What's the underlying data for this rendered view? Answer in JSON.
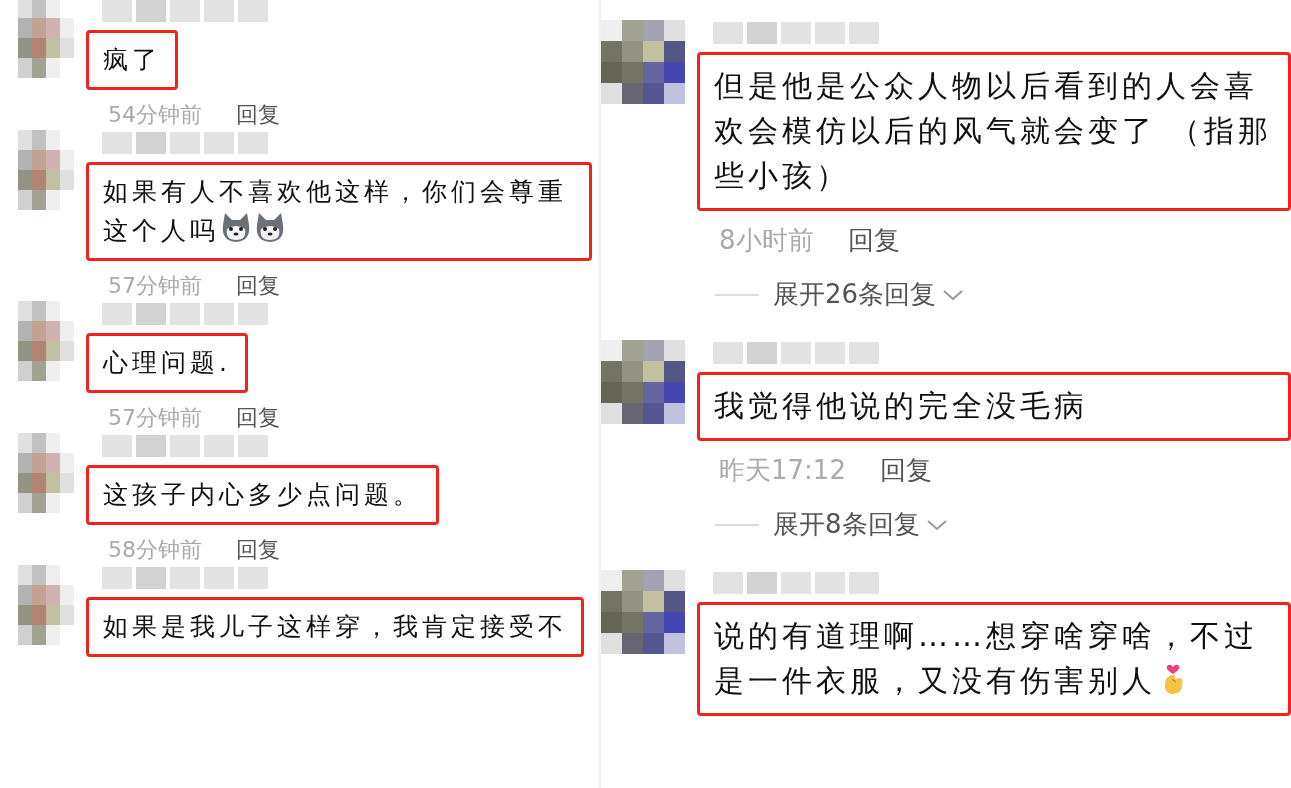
{
  "left_comments": [
    {
      "text": "疯了",
      "time": "54分钟前",
      "reply": "回复"
    },
    {
      "text": "如果有人不喜欢他这样，你们会尊重这个人吗",
      "stickers": [
        {
          "kind": "husky"
        },
        {
          "kind": "husky"
        }
      ],
      "time": "57分钟前",
      "reply": "回复"
    },
    {
      "text": "心理问题.",
      "time": "57分钟前",
      "reply": "回复"
    },
    {
      "text": "这孩子内心多少点问题。",
      "time": "58分钟前",
      "reply": "回复"
    },
    {
      "text": "如果是我儿子这样穿，我肯定接受不"
    }
  ],
  "right_comments": [
    {
      "text": "但是他是公众人物以后看到的人会喜欢会模仿以后的风气就会变了 （指那些小孩）",
      "time": "8小时前",
      "reply": "回复",
      "expand": "展开26条回复"
    },
    {
      "text": "我觉得他说的完全没毛病",
      "time": "昨天17:12",
      "reply": "回复",
      "expand": "展开8条回复"
    },
    {
      "text": "说的有道理啊……想穿啥穿啥，不过是一件衣服，又没有伤害别人",
      "stickers": [
        {
          "kind": "finger-heart"
        }
      ]
    }
  ]
}
